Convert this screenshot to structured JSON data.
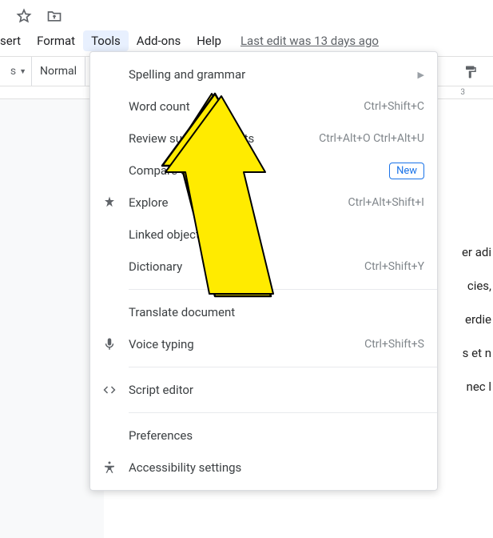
{
  "top_icons": [
    "star-icon",
    "move-folder-icon"
  ],
  "menubar": {
    "items": [
      {
        "label": "sert",
        "partial": true
      },
      {
        "label": "Format"
      },
      {
        "label": "Tools",
        "active": true
      },
      {
        "label": "Add-ons"
      },
      {
        "label": "Help"
      }
    ],
    "last_edit": "Last edit was 13 days ago"
  },
  "toolbar": {
    "left_fragment": "s",
    "style_fragment": "Normal",
    "paint_icon": "paint-format-icon",
    "ruler_tick": "3"
  },
  "dropdown": {
    "items": [
      {
        "label": "Spelling and grammar",
        "submenu": true
      },
      {
        "label": "Word count",
        "shortcut": "Ctrl+Shift+C"
      },
      {
        "label": "Review suggested edits",
        "shortcut": "Ctrl+Alt+O Ctrl+Alt+U"
      },
      {
        "label": "Compare documents",
        "badge": "New"
      },
      {
        "label": "Explore",
        "shortcut": "Ctrl+Alt+Shift+I",
        "icon": "explore-icon"
      },
      {
        "label": "Linked objects"
      },
      {
        "label": "Dictionary",
        "shortcut": "Ctrl+Shift+Y"
      },
      {
        "sep": true
      },
      {
        "label": "Translate document"
      },
      {
        "label": "Voice typing",
        "shortcut": "Ctrl+Shift+S",
        "icon": "mic-icon"
      },
      {
        "sep": true
      },
      {
        "label": "Script editor",
        "icon": "code-icon"
      },
      {
        "sep": true
      },
      {
        "label": "Preferences"
      },
      {
        "label": "Accessibility settings",
        "icon": "accessibility-icon"
      }
    ]
  },
  "document_lines": [
    "er adi",
    "cies,",
    "erdie",
    "s et n",
    "nec l"
  ],
  "annotation": {
    "type": "arrow",
    "color": "#FFEB00"
  }
}
